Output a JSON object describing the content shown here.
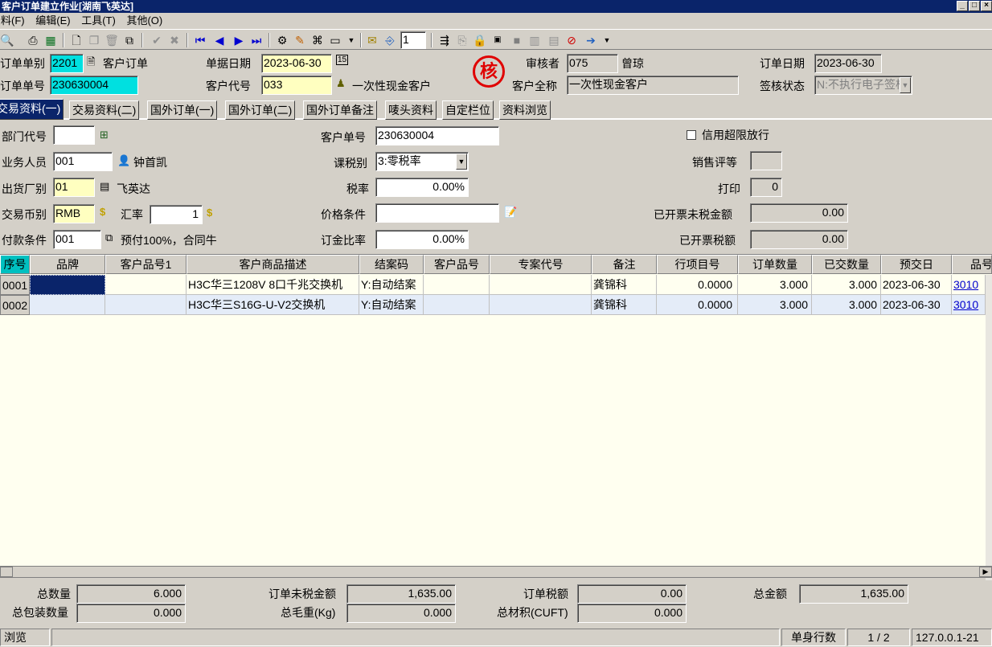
{
  "window": {
    "title": "客户订单建立作业[湖南飞英达]"
  },
  "menu": [
    "资料(F)",
    "编辑(E)",
    "工具(T)",
    "其他(O)"
  ],
  "toolbar": {
    "page_value": "1"
  },
  "header": {
    "order_type_label": "订单单别",
    "order_type_value": "2201",
    "order_type_name": "客户订单",
    "order_no_label": "订单单号",
    "order_no_value": "230630004",
    "doc_date_label": "单据日期",
    "doc_date_value": "2023-06-30",
    "customer_code_label": "客户代号",
    "customer_code_value": "033",
    "customer_short": "一次性现金客户",
    "stamp_text": "核",
    "reviewer_label": "审核者",
    "reviewer_code": "075",
    "reviewer_name": "曾琼",
    "customer_full_label": "客户全称",
    "customer_full_value": "一次性现金客户",
    "order_date_label": "订单日期",
    "order_date_value": "2023-06-30",
    "sign_status_label": "签核状态",
    "sign_status_value": "N:不执行电子签核"
  },
  "tabs": [
    "交易资料(一)",
    "交易资料(二)",
    "国外订单(一)",
    "国外订单(二)",
    "国外订单备注",
    "唛头资料",
    "自定栏位",
    "资料浏览"
  ],
  "form": {
    "dept_label": "部门代号",
    "dept_value": "",
    "sales_label": "业务人员",
    "sales_value": "001",
    "sales_name": "钟首凯",
    "factory_label": "出货厂别",
    "factory_value": "01",
    "factory_name": "飞英达",
    "currency_label": "交易币别",
    "currency_value": "RMB",
    "rate_label": "汇率",
    "rate_value": "1",
    "payment_label": "付款条件",
    "payment_value": "001",
    "payment_desc": "预付100%，合同牛",
    "cust_order_label": "客户单号",
    "cust_order_value": "230630004",
    "tax_type_label": "课税别",
    "tax_type_value": "3:零税率",
    "tax_rate_label": "税率",
    "tax_rate_value": "0.00%",
    "price_cond_label": "价格条件",
    "price_cond_value": "",
    "deposit_label": "订金比率",
    "deposit_value": "0.00%",
    "credit_label": "信用超限放行",
    "sales_grade_label": "销售评等",
    "sales_grade_value": "",
    "print_label": "打印",
    "print_value": "0",
    "invoiced_untaxed_label": "已开票未税金额",
    "invoiced_untaxed_value": "0.00",
    "invoiced_tax_label": "已开票税额",
    "invoiced_tax_value": "0.00"
  },
  "grid": {
    "headers": [
      "序号",
      "品牌",
      "客户品号1",
      "客户商品描述",
      "结案码",
      "客户品号",
      "专案代号",
      "备注",
      "行项目号",
      "订单数量",
      "已交数量",
      "预交日",
      "品号"
    ],
    "rows": [
      [
        "0001",
        "",
        "",
        "H3C华三1208V 8口千兆交换机",
        "Y:自动结案",
        "",
        "",
        "龚锦科",
        "0.0000",
        "3.000",
        "3.000",
        "2023-06-30",
        "3010"
      ],
      [
        "0002",
        "",
        "",
        "H3C华三S16G-U-V2交换机",
        "Y:自动结案",
        "",
        "",
        "龚锦科",
        "0.0000",
        "3.000",
        "3.000",
        "2023-06-30",
        "3010"
      ]
    ]
  },
  "totals": {
    "total_qty_label": "总数量",
    "total_qty_value": "6.000",
    "untaxed_label": "订单未税金额",
    "untaxed_value": "1,635.00",
    "tax_label": "订单税额",
    "tax_value": "0.00",
    "total_amount_label": "总金额",
    "total_amount_value": "1,635.00",
    "pack_qty_label": "总包装数量",
    "pack_qty_value": "0.000",
    "gross_weight_label": "总毛重(Kg)",
    "gross_weight_value": "0.000",
    "volume_label": "总材积(CUFT)",
    "volume_value": "0.000"
  },
  "status": {
    "mode": "浏览",
    "rows_label": "单身行数",
    "rows_value": "1 / 2",
    "ip": "127.0.0.1-21"
  }
}
